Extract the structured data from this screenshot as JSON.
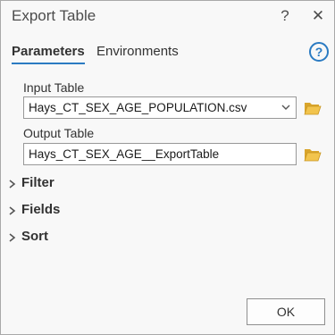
{
  "window": {
    "title": "Export Table",
    "help_glyph": "?",
    "close_glyph": "✕"
  },
  "tabs": [
    {
      "label": "Parameters",
      "active": true
    },
    {
      "label": "Environments",
      "active": false
    }
  ],
  "help_icon": "question-circle-icon",
  "params": {
    "input_table": {
      "label": "Input Table",
      "value": "Hays_CT_SEX_AGE_POPULATION.csv",
      "icon": "folder-open-icon"
    },
    "output_table": {
      "label": "Output Table",
      "value": "Hays_CT_SEX_AGE__ExportTable",
      "icon": "folder-open-icon"
    }
  },
  "sections": [
    {
      "label": "Filter"
    },
    {
      "label": "Fields"
    },
    {
      "label": "Sort"
    }
  ],
  "buttons": {
    "ok_label": "OK"
  },
  "colors": {
    "accent": "#2b7bc2",
    "folder": "#e8b83a"
  }
}
